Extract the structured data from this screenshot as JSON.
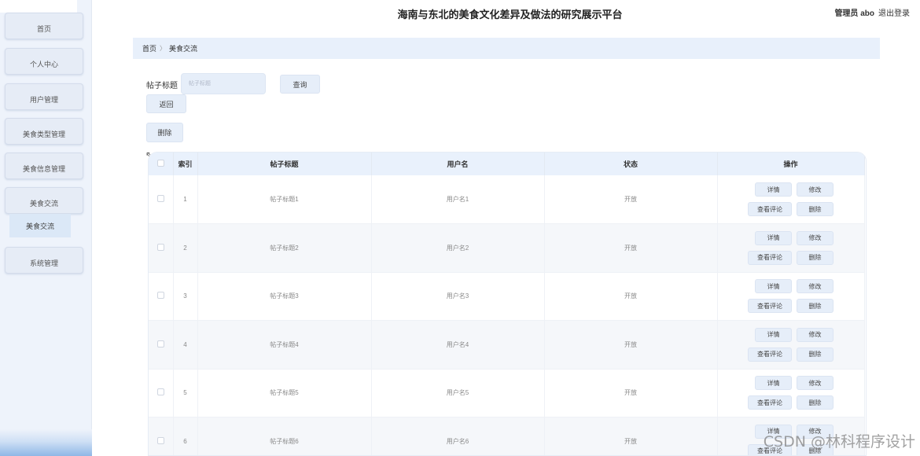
{
  "header": {
    "title": "海南与东北的美食文化差异及做法的研究展示平台",
    "user": "管理员 abo",
    "logout": "退出登录"
  },
  "sidebar": {
    "items": [
      {
        "label": "首页"
      },
      {
        "label": "个人中心"
      },
      {
        "label": "用户管理"
      },
      {
        "label": "美食类型管理"
      },
      {
        "label": "美食信息管理"
      },
      {
        "label": "美食交流"
      },
      {
        "label": "系统管理"
      }
    ],
    "sub_item": "美食交流"
  },
  "breadcrumb": {
    "home": "首页",
    "separator": "〉",
    "current": "美食交流"
  },
  "search": {
    "label": "帖子标题",
    "placeholder": "帖子标题",
    "query_button": "查询",
    "back_button": "返回"
  },
  "toolbar": {
    "delete_button": "删除"
  },
  "table": {
    "headers": {
      "index": "索引",
      "title": "帖子标题",
      "username": "用户名",
      "status": "状态",
      "actions": "操作"
    },
    "actions": {
      "detail": "详情",
      "edit": "修改",
      "comments": "查看评论",
      "delete": "删除"
    },
    "rows": [
      {
        "index": "1",
        "title": "帖子标题1",
        "username": "用户名1",
        "status": "开放"
      },
      {
        "index": "2",
        "title": "帖子标题2",
        "username": "用户名2",
        "status": "开放"
      },
      {
        "index": "3",
        "title": "帖子标题3",
        "username": "用户名3",
        "status": "开放"
      },
      {
        "index": "4",
        "title": "帖子标题4",
        "username": "用户名4",
        "status": "开放"
      },
      {
        "index": "5",
        "title": "帖子标题5",
        "username": "用户名5",
        "status": "开放"
      },
      {
        "index": "6",
        "title": "帖子标题6",
        "username": "用户名6",
        "status": "开放"
      }
    ]
  },
  "watermark": "CSDN @林科程序设计",
  "colors": {
    "sidebar_bg": "#eef3fb",
    "button_bg": "#e6eef9",
    "header_row_bg": "#e9f1fc",
    "alt_row_bg": "#f5f7fa"
  }
}
